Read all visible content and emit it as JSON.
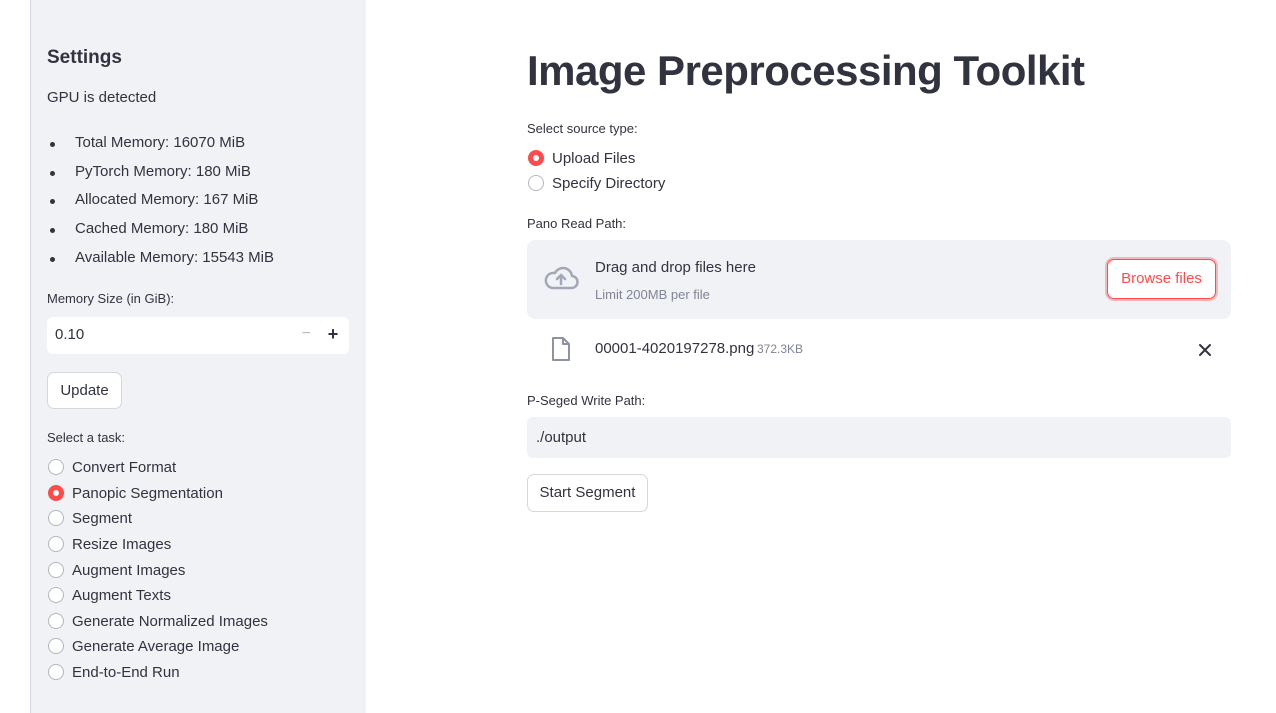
{
  "sidebar": {
    "title": "Settings",
    "gpu_status": "GPU is detected",
    "memory_items": [
      "Total Memory: 16070 MiB",
      "PyTorch Memory: 180 MiB",
      "Allocated Memory: 167 MiB",
      "Cached Memory: 180 MiB",
      "Available Memory: 15543 MiB"
    ],
    "memory_size_label": "Memory Size (in GiB):",
    "memory_size_value": "0.10",
    "update_label": "Update",
    "task_label": "Select a task:",
    "tasks": [
      {
        "label": "Convert Format",
        "checked": false
      },
      {
        "label": "Panopic Segmentation",
        "checked": true
      },
      {
        "label": "Segment",
        "checked": false
      },
      {
        "label": "Resize Images",
        "checked": false
      },
      {
        "label": "Augment Images",
        "checked": false
      },
      {
        "label": "Augment Texts",
        "checked": false
      },
      {
        "label": "Generate Normalized Images",
        "checked": false
      },
      {
        "label": "Generate Average Image",
        "checked": false
      },
      {
        "label": "End-to-End Run",
        "checked": false
      }
    ]
  },
  "main": {
    "title": "Image Preprocessing Toolkit",
    "source_type_label": "Select source type:",
    "source_options": [
      {
        "label": "Upload Files",
        "checked": true
      },
      {
        "label": "Specify Directory",
        "checked": false
      }
    ],
    "pano_read_label": "Pano Read Path:",
    "dropzone": {
      "text": "Drag and drop files here",
      "limit": "Limit 200MB per file",
      "browse_label": "Browse files",
      "icon": "cloud-upload-icon"
    },
    "uploaded_file": {
      "name": "00001-4020197278.png",
      "size": "372.3KB",
      "icon": "file-icon"
    },
    "write_path_label": "P-Seged Write Path:",
    "write_path_value": "./output",
    "start_label": "Start Segment"
  },
  "colors": {
    "accent": "#ff4b4b",
    "sidebar_bg": "#f0f2f6",
    "text": "#31333f",
    "muted_text": "#808495"
  }
}
